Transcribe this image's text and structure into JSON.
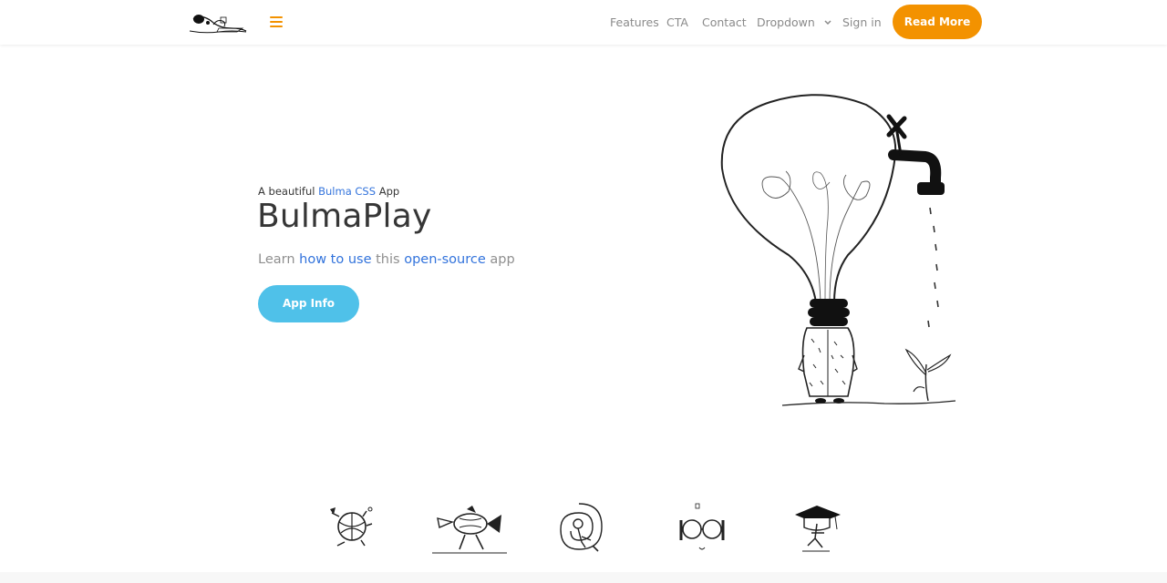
{
  "navbar": {
    "brand_logo": "doodle-logo",
    "menu_icon": "hamburger-icon",
    "items": [
      {
        "label": "Features"
      },
      {
        "label": "CTA"
      },
      {
        "label": "Contact"
      },
      {
        "label": "Dropdown",
        "icon": "chevron-down-icon"
      },
      {
        "label": "Sign in"
      }
    ],
    "cta_label": "Read More",
    "accent_color": "#f39200"
  },
  "hero": {
    "tagline": {
      "prefix": "A beautiful ",
      "link": "Bulma CSS",
      "suffix": " App"
    },
    "title": "BulmaPlay",
    "subtitle": {
      "part1": "Learn ",
      "link1": "how to use",
      "part2": " this ",
      "link2": "open-source",
      "part3": " app"
    },
    "button_label": "App Info",
    "button_color": "#4fc1e9",
    "illustration": "lightbulb-faucet-plant"
  },
  "features": [
    {
      "icon": "juggling-ball-icon"
    },
    {
      "icon": "fish-walker-icon"
    },
    {
      "icon": "spiral-figure-icon"
    },
    {
      "icon": "glasses-face-icon"
    },
    {
      "icon": "graduation-cap-icon"
    }
  ]
}
